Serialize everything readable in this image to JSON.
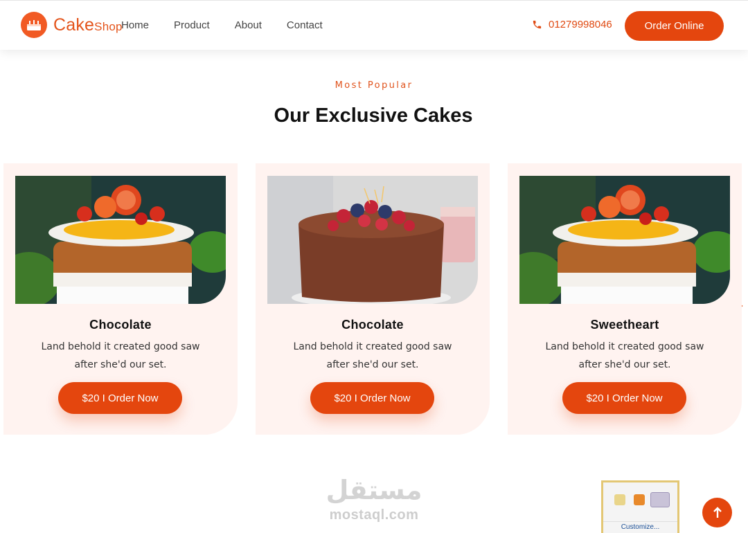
{
  "header": {
    "logo_main": "Cake",
    "logo_small": "Shop",
    "nav": [
      {
        "label": "Home"
      },
      {
        "label": "Product"
      },
      {
        "label": "About"
      },
      {
        "label": "Contact"
      }
    ],
    "phone": "01279998046",
    "cta_label": "Order Online"
  },
  "section": {
    "eyebrow": "Most Popular",
    "title": "Our Exclusive Cakes"
  },
  "cards": [
    {
      "title": "Chocolate",
      "description": "Land behold it created good saw after she'd our set.",
      "button": "$20 I Order Now",
      "image": "orange-cake-photo"
    },
    {
      "title": "Chocolate",
      "description": "Land behold it created good saw after she'd our set.",
      "button": "$20 I Order Now",
      "image": "berry-chocolate-cake-photo"
    },
    {
      "title": "Sweetheart",
      "description": "Land behold it created good saw after she'd our set.",
      "button": "$20 I Order Now",
      "image": "orange-cake-photo"
    }
  ],
  "carousel": {
    "prev_icon": "chevron-left-icon",
    "next_icon": "chevron-right-icon"
  },
  "watermark": {
    "arabic": "مستقل",
    "latin": "mostaql.com"
  },
  "tray_popup": {
    "link": "Customize..."
  },
  "scroll_top_icon": "arrow-up-icon",
  "colors": {
    "accent": "#e4460e",
    "card_bg": "#fff3f0",
    "eyebrow": "#e0531c"
  }
}
